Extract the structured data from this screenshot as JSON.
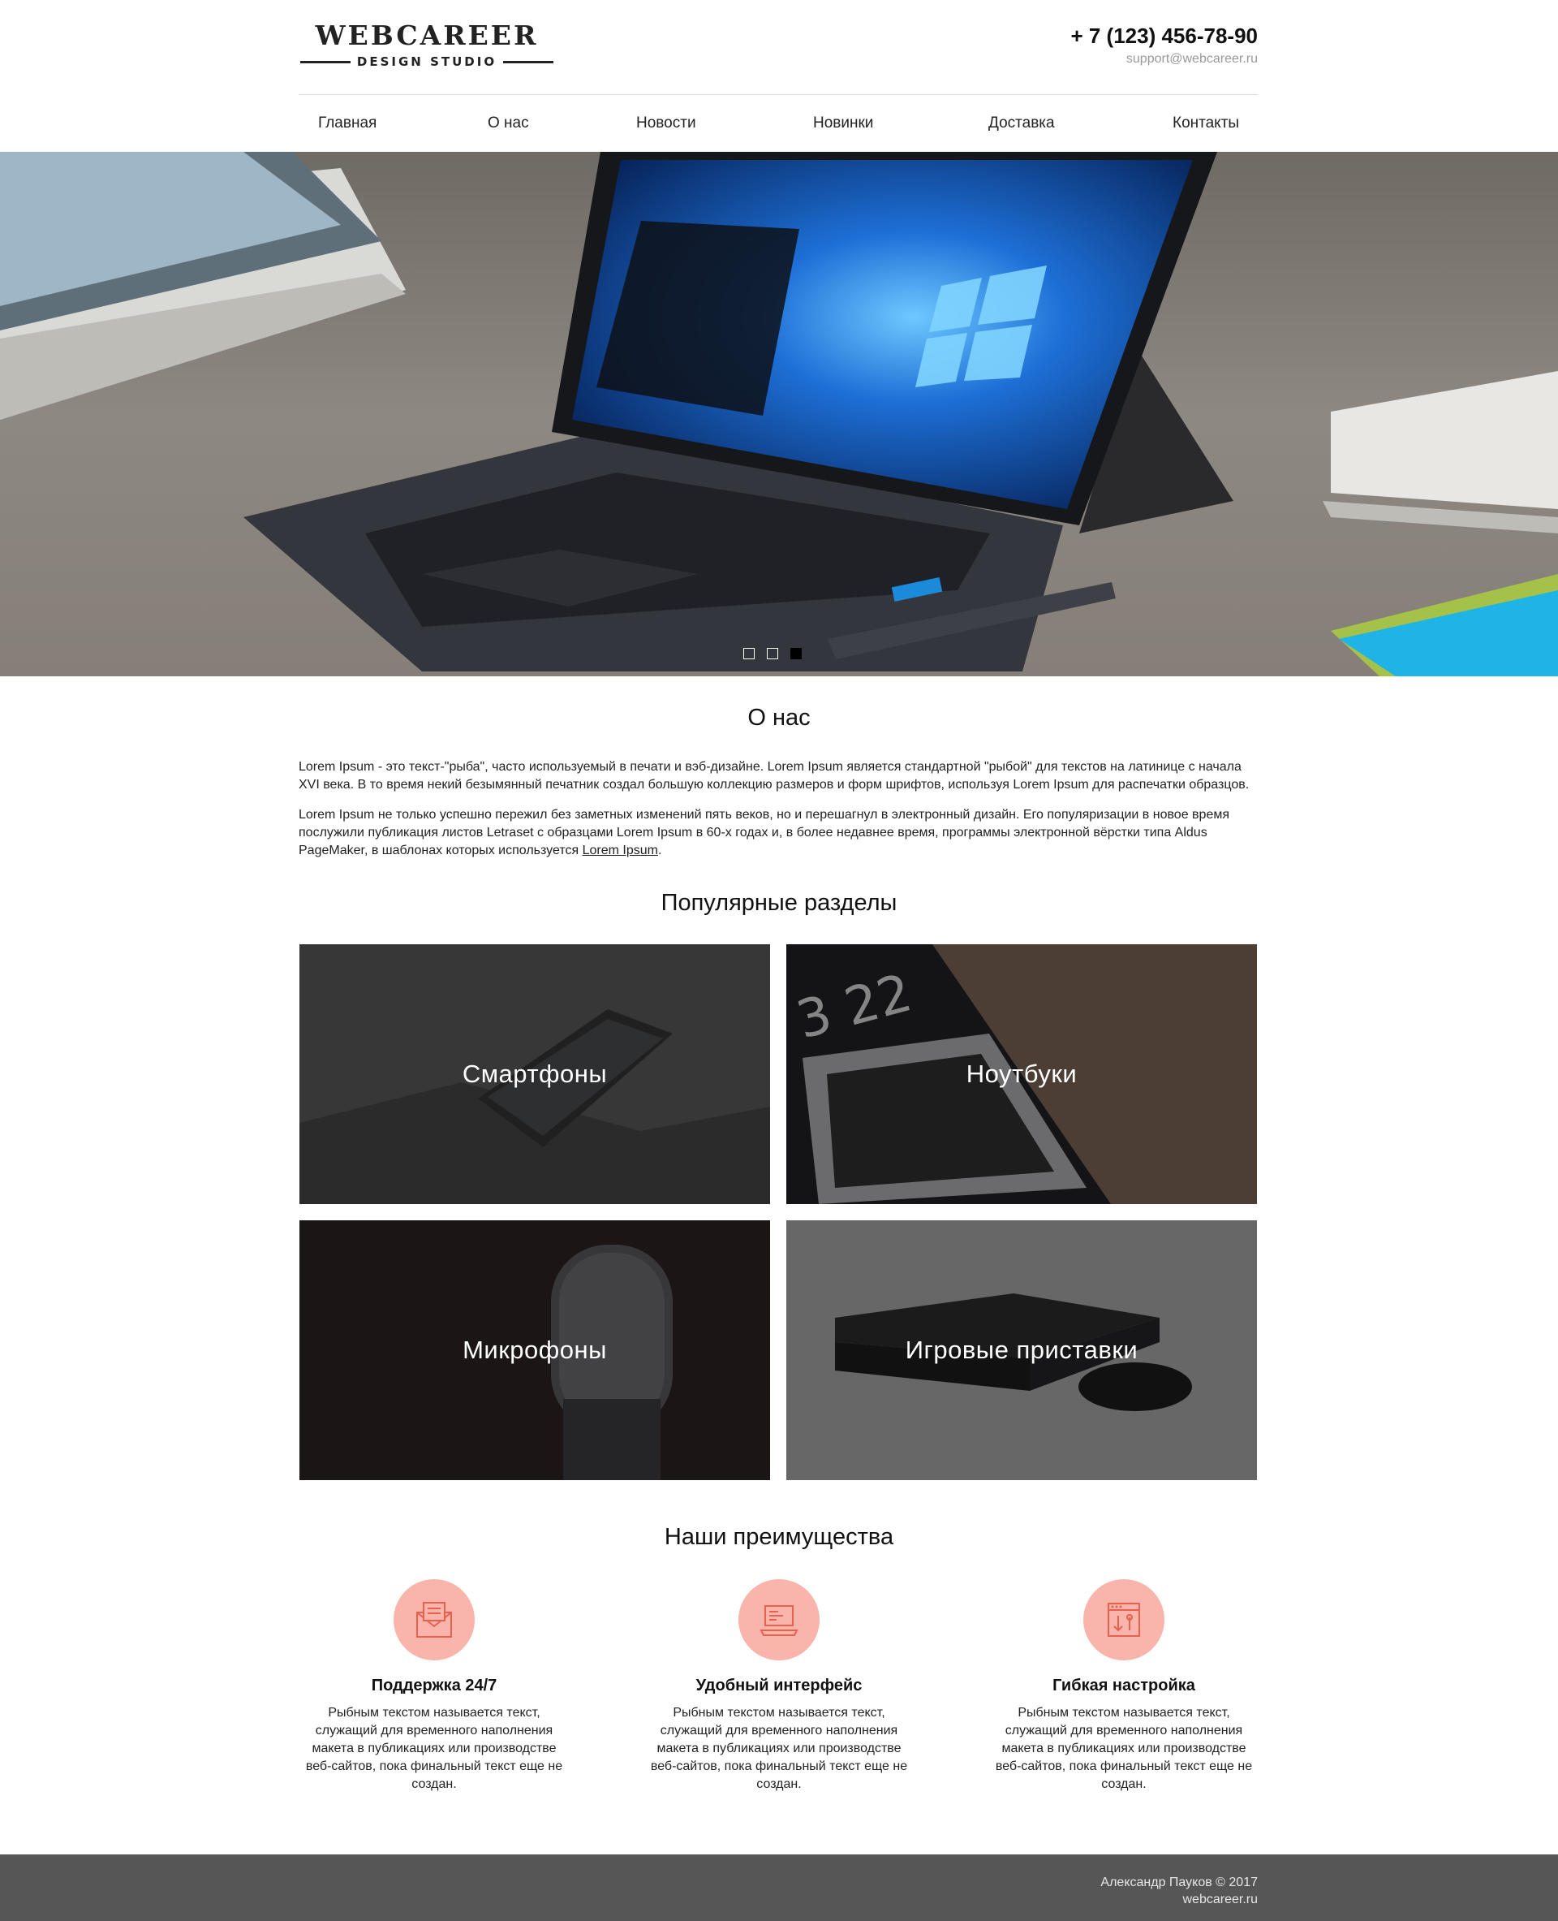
{
  "header": {
    "logo_main": "WEBCAREER",
    "logo_sub": "DESIGN STUDIO",
    "phone": "+ 7 (123) 456-78-90",
    "email": "support@webcareer.ru"
  },
  "nav": {
    "items": [
      {
        "label": "Главная",
        "active": true
      },
      {
        "label": "О нас",
        "active": false
      },
      {
        "label": "Новости",
        "active": false
      },
      {
        "label": "Новинки",
        "active": false
      },
      {
        "label": "Доставка",
        "active": false
      },
      {
        "label": "Контакты",
        "active": false
      }
    ]
  },
  "slider": {
    "slide_count": 3,
    "active_slide": 3
  },
  "about": {
    "title": "О нас",
    "p1": "Lorem Ipsum - это текст-\"рыба\", часто используемый в печати и вэб-дизайне. Lorem Ipsum является стандартной \"рыбой\" для текстов на латинице с начала XVI века. В то время некий безымянный печатник создал большую коллекцию размеров и форм шрифтов, используя Lorem Ipsum для распечатки образцов.",
    "p2_text": "Lorem Ipsum не только успешно пережил без заметных изменений пять веков, но и перешагнул в электронный дизайн. Его популяризации в новое время послужили публикация листов Letraset с образцами Lorem Ipsum в 60-х годах и, в более недавнее время, программы электронной вёрстки типа Aldus PageMaker, в шаблонах которых используется ",
    "p2_link": "Lorem Ipsum",
    "p2_end": "."
  },
  "popular": {
    "title": "Популярные разделы",
    "items": [
      {
        "label": "Смартфоны"
      },
      {
        "label": "Ноутбуки"
      },
      {
        "label": "Микрофоны"
      },
      {
        "label": "Игровые приставки"
      }
    ]
  },
  "advantages": {
    "title": "Наши преимущества",
    "items": [
      {
        "title": "Поддержка 24/7",
        "text": "Рыбным текстом называется текст, служащий для временного наполнения макета в публикациях или производстве веб-сайтов, пока финальный текст еще не создан.",
        "icon": "envelope-icon"
      },
      {
        "title": "Удобный интерфейс",
        "text": "Рыбным текстом называется текст, служащий для временного наполнения макета в публикациях или производстве веб-сайтов, пока финальный текст еще не создан.",
        "icon": "laptop-code-icon"
      },
      {
        "title": "Гибкая настройка",
        "text": "Рыбным текстом называется текст, служащий для временного наполнения макета в публикациях или производстве веб-сайтов, пока финальный текст еще не создан.",
        "icon": "settings-window-icon"
      }
    ]
  },
  "footer": {
    "author": "Александр Пауков © 2017",
    "site": "webcareer.ru"
  },
  "colors": {
    "accent": "#e8604e",
    "icon_bg": "#f9b4ab",
    "footer_bg": "#565656"
  }
}
